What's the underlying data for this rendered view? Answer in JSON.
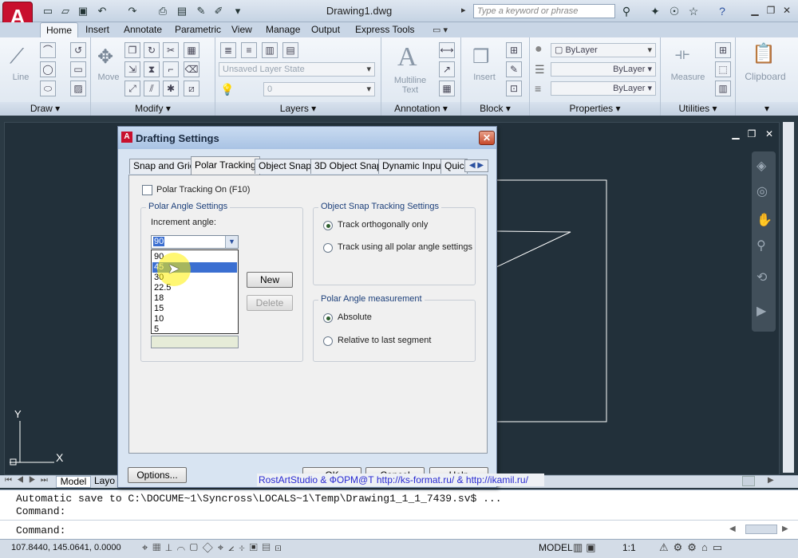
{
  "app": {
    "title": "Drawing1.dwg",
    "search_placeholder": "Type a keyword or phrase"
  },
  "ribbon_tabs": [
    "Home",
    "Insert",
    "Annotate",
    "Parametric",
    "View",
    "Manage",
    "Output",
    "Express Tools"
  ],
  "ribbon_panels": {
    "draw": {
      "label": "Draw",
      "line": "Line"
    },
    "modify": {
      "label": "Modify",
      "move": "Move"
    },
    "layers": {
      "label": "Layers",
      "layer_state": "Unsaved Layer State",
      "layer_value": "0"
    },
    "annotation": {
      "label": "Annotation",
      "multiline": "Multiline",
      "text": "Text"
    },
    "block": {
      "label": "Block",
      "insert": "Insert"
    },
    "properties": {
      "label": "Properties",
      "color": "ByLayer",
      "linetype": "ByLayer",
      "lineweight": "ByLayer"
    },
    "utilities": {
      "label": "Utilities",
      "measure": "Measure"
    },
    "clipboard": {
      "label": "Clipboard"
    }
  },
  "dialog": {
    "title": "Drafting Settings",
    "close": "✕",
    "tabs": [
      "Snap and Grid",
      "Polar Tracking",
      "Object Snap",
      "3D Object Snap",
      "Dynamic Input",
      "Quic"
    ],
    "polar_on": "Polar Tracking On (F10)",
    "angle_group": "Polar Angle Settings",
    "increment_label": "Increment angle:",
    "increment_value": "90",
    "angles": [
      "90",
      "45",
      "30",
      "22.5",
      "18",
      "15",
      "10",
      "5"
    ],
    "selected_angle": "45",
    "new_btn": "New",
    "delete_btn": "Delete",
    "osnap_group": "Object Snap Tracking Settings",
    "track_ortho": "Track orthogonally only",
    "track_polar": "Track using all polar angle settings",
    "measure_group": "Polar Angle measurement",
    "absolute": "Absolute",
    "relative": "Relative to last segment",
    "options_btn": "Options...",
    "ok_btn": "OK",
    "cancel_btn": "Cancel",
    "help_btn": "Help"
  },
  "layout_tabs": {
    "model": "Model",
    "layout": "Layo"
  },
  "watermark": "RostArtStudio & ФОРМ@Т http://ks-format.ru/ & http://ikamil.ru/",
  "command": {
    "line1": "Automatic save to C:\\DOCUME~1\\Syncross\\LOCALS~1\\Temp\\Drawing1_1_1_7439.sv$ ...",
    "line2": "Command:",
    "line3": "Command:"
  },
  "status": {
    "coords": "107.8440, 145.0641, 0.0000",
    "model": "MODEL",
    "scale": "1:1"
  },
  "ucs": {
    "x": "X",
    "y": "Y"
  }
}
